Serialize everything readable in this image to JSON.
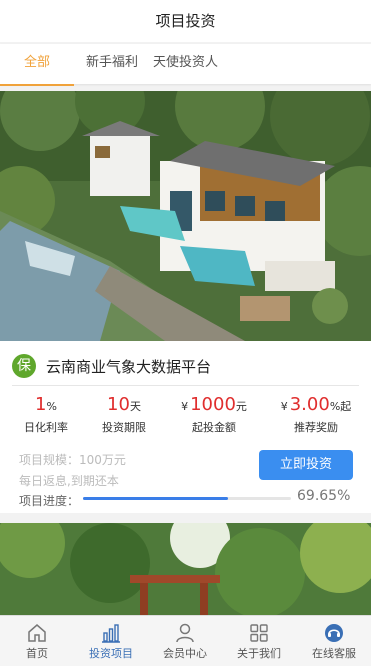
{
  "header": {
    "title": "项目投资"
  },
  "tabs": [
    {
      "label": "全部",
      "active": true
    },
    {
      "label": "新手福利",
      "active": false
    },
    {
      "label": "天使投资人",
      "active": false
    }
  ],
  "project": {
    "badge": "保",
    "title": "云南商业气象大数据平台",
    "stats": [
      {
        "prefix": "",
        "value": "1",
        "unit": "%",
        "label": "日化利率"
      },
      {
        "prefix": "",
        "value": "10",
        "unit": "天",
        "label": "投资期限"
      },
      {
        "prefix": "¥",
        "value": "1000",
        "unit": "元",
        "label": "起投金额"
      },
      {
        "prefix": "¥",
        "value": "3.00",
        "unit": "%起",
        "label": "推荐奖励"
      }
    ],
    "scale": "项目规模：100万元",
    "repay": "每日返息,到期还本",
    "invest_button": "立即投资",
    "progress_label": "项目进度：",
    "progress_value": 0.6965,
    "progress_text": "69.65%"
  },
  "nav": [
    {
      "label": "首页",
      "icon": "home-icon",
      "active": false
    },
    {
      "label": "投资项目",
      "icon": "bar-chart-icon",
      "active": true
    },
    {
      "label": "会员中心",
      "icon": "user-icon",
      "active": false
    },
    {
      "label": "关于我们",
      "icon": "grid-icon",
      "active": false
    },
    {
      "label": "在线客服",
      "icon": "headset-icon",
      "active": false
    }
  ],
  "colors": {
    "accent": "#f0a23a",
    "button": "#3a8ef0",
    "value_red": "#e02e2e",
    "badge_green": "#5fa72c"
  }
}
